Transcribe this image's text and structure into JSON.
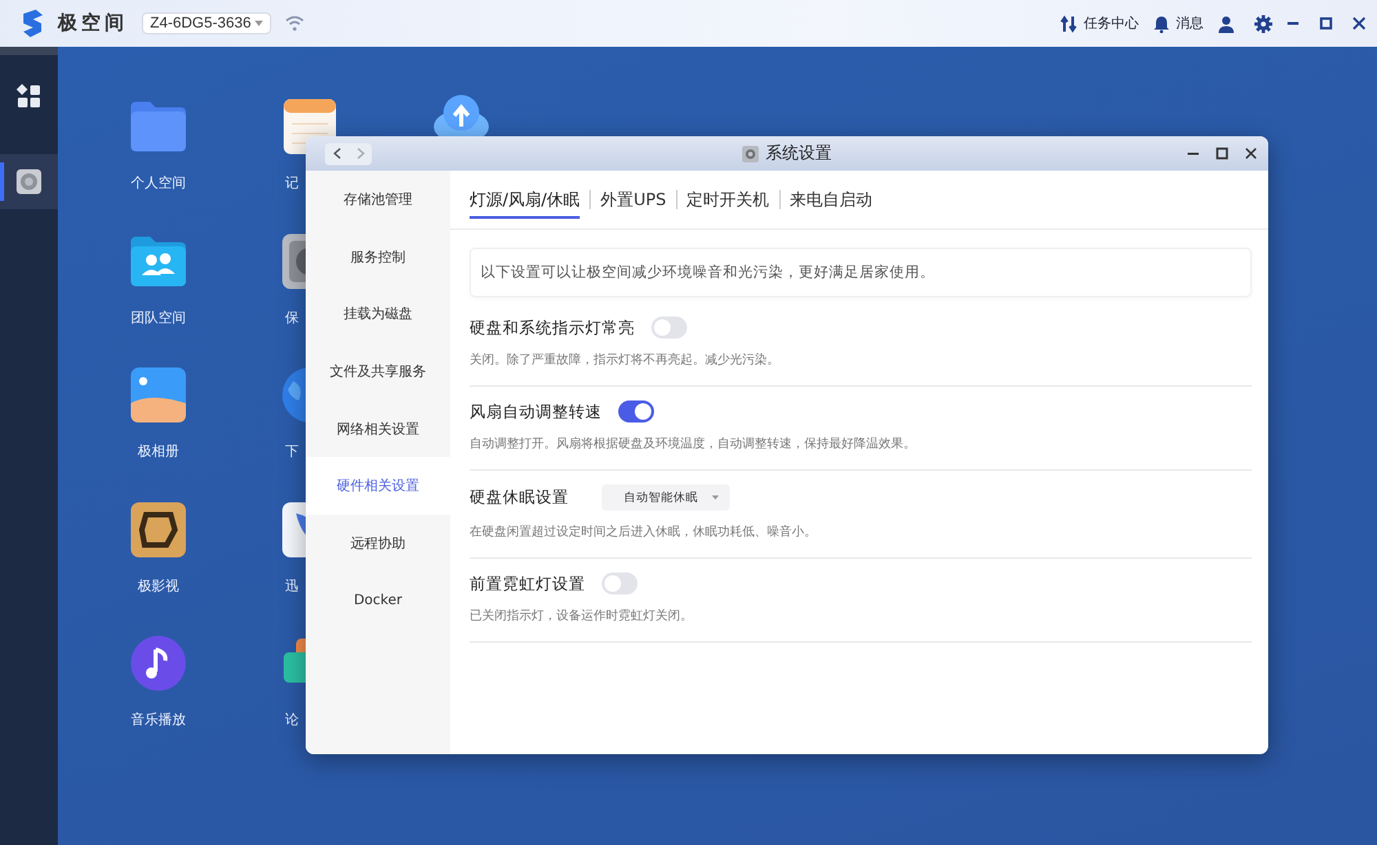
{
  "topbar": {
    "app_name": "极空间",
    "device": "Z4-6DG5-3636",
    "actions": [
      {
        "label": "任务中心"
      },
      {
        "label": "消息"
      }
    ]
  },
  "dock": {
    "items": [
      {
        "selected": false
      },
      {
        "selected": true
      }
    ]
  },
  "desktop": {
    "icons": [
      {
        "label": "个人空间"
      },
      {
        "label": "记"
      },
      {
        "kind": "partial"
      },
      {
        "label": "团队空间"
      },
      {
        "label": "保"
      },
      {
        "label": "极相册"
      },
      {
        "label": "下"
      },
      {
        "label": "极影视"
      },
      {
        "label": "迅"
      },
      {
        "label": "音乐播放"
      },
      {
        "label": "论"
      }
    ]
  },
  "dialog": {
    "title": "系统设置",
    "nav": [
      {
        "label": "存储池管理",
        "selected": false
      },
      {
        "label": "服务控制",
        "selected": false
      },
      {
        "label": "挂载为磁盘",
        "selected": false
      },
      {
        "label": "文件及共享服务",
        "selected": false
      },
      {
        "label": "网络相关设置",
        "selected": false
      },
      {
        "label": "硬件相关设置",
        "selected": true
      },
      {
        "label": "远程协助",
        "selected": false
      },
      {
        "label": "Docker",
        "selected": false
      }
    ],
    "tabs": [
      {
        "label": "灯源/风扇/休眠",
        "selected": true
      },
      {
        "label": "外置UPS",
        "selected": false
      },
      {
        "label": "定时开关机",
        "selected": false
      },
      {
        "label": "来电自启动",
        "selected": false
      }
    ],
    "notice": "以下设置可以让极空间减少环境噪音和光污染，更好满足居家使用。",
    "settings": [
      {
        "kind": "toggle",
        "label": "硬盘和系统指示灯常亮",
        "on": false,
        "description": "关闭。除了严重故障，指示灯将不再亮起。减少光污染。"
      },
      {
        "kind": "toggle",
        "label": "风扇自动调整转速",
        "on": true,
        "description": "自动调整打开。风扇将根据硬盘及环境温度，自动调整转速，保持最好降温效果。"
      },
      {
        "kind": "select",
        "label": "硬盘休眠设置",
        "value": "自动智能休眠",
        "description": "在硬盘闲置超过设定时间之后进入休眠，休眠功耗低、噪音小。"
      },
      {
        "kind": "toggle",
        "label": "前置霓虹灯设置",
        "on": false,
        "description": "已关闭指示灯，设备运作时霓虹灯关闭。"
      }
    ]
  }
}
